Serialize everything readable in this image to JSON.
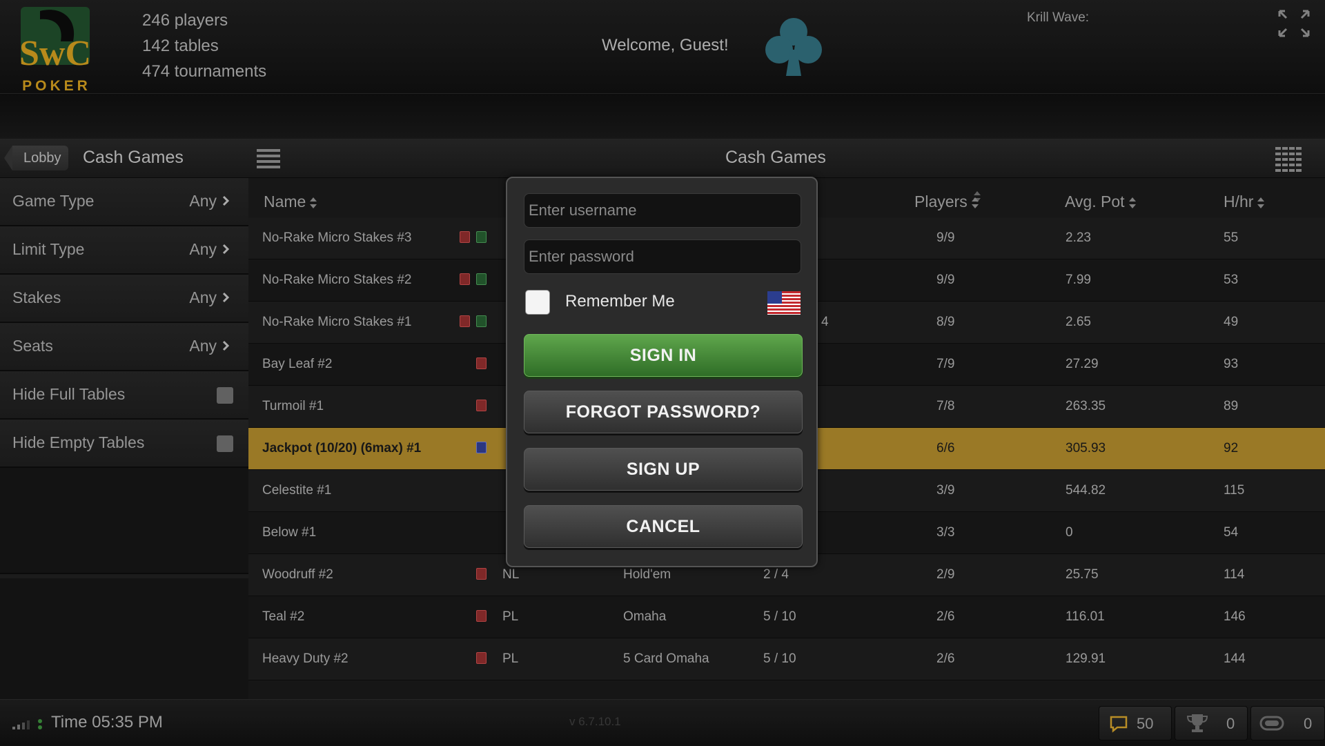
{
  "header": {
    "logo_text": "SwC",
    "logo_sub": "POKER",
    "stats": [
      "246 players",
      "142 tables",
      "474 tournaments"
    ],
    "welcome": "Welcome, Guest!",
    "krill": "Krill Wave:",
    "club_icon": "club-suit-icon",
    "fullscreen_icon": "fullscreen-icon"
  },
  "toolbar": {
    "lobby": "Lobby",
    "title": "Cash Games",
    "center_title": "Cash Games",
    "menu_icon": "hamburger-menu-icon",
    "grid_icon": "grid-view-icon"
  },
  "sidebar": {
    "filters": [
      {
        "label": "Game Type",
        "value": "Any"
      },
      {
        "label": "Limit Type",
        "value": "Any"
      },
      {
        "label": "Stakes",
        "value": "Any"
      },
      {
        "label": "Seats",
        "value": "Any"
      }
    ],
    "toggles": [
      {
        "label": "Hide Full Tables",
        "checked": false
      },
      {
        "label": "Hide Empty Tables",
        "checked": false
      }
    ]
  },
  "table": {
    "columns": {
      "name": "Name",
      "players": "Players",
      "avg_pot": "Avg. Pot",
      "hhr": "H/hr"
    },
    "rows": [
      {
        "name": "No-Rake Micro Stakes #3",
        "icons": [
          "red",
          "green"
        ],
        "limit": "",
        "game": "",
        "stakes": "",
        "players": "9/9",
        "avg_pot": "2.23",
        "hhr": "55",
        "highlight": false
      },
      {
        "name": "No-Rake Micro Stakes #2",
        "icons": [
          "red",
          "green"
        ],
        "limit": "",
        "game": "",
        "stakes": "",
        "players": "9/9",
        "avg_pot": "7.99",
        "hhr": "53",
        "highlight": false
      },
      {
        "name": "No-Rake Micro Stakes #1",
        "icons": [
          "red",
          "green"
        ],
        "limit": "",
        "game": "",
        "stakes": "4",
        "players": "8/9",
        "avg_pot": "2.65",
        "hhr": "49",
        "highlight": false
      },
      {
        "name": "Bay Leaf #2",
        "icons": [
          "red"
        ],
        "limit": "",
        "game": "",
        "stakes": "",
        "players": "7/9",
        "avg_pot": "27.29",
        "hhr": "93",
        "highlight": false
      },
      {
        "name": "Turmoil #1",
        "icons": [
          "red"
        ],
        "limit": "",
        "game": "",
        "stakes": "",
        "players": "7/8",
        "avg_pot": "263.35",
        "hhr": "89",
        "highlight": false
      },
      {
        "name": "Jackpot (10/20) (6max) #1",
        "icons": [
          "blue"
        ],
        "limit": "",
        "game": "",
        "stakes": "",
        "players": "6/6",
        "avg_pot": "305.93",
        "hhr": "92",
        "highlight": true
      },
      {
        "name": "Celestite #1",
        "icons": [],
        "limit": "",
        "game": "",
        "stakes": "",
        "players": "3/9",
        "avg_pot": "544.82",
        "hhr": "115",
        "highlight": false
      },
      {
        "name": "Below #1",
        "icons": [],
        "limit": "",
        "game": "",
        "stakes": "",
        "players": "3/3",
        "avg_pot": "0",
        "hhr": "54",
        "highlight": false
      },
      {
        "name": "Woodruff #2",
        "icons": [
          "red"
        ],
        "limit": "NL",
        "game": "Hold'em",
        "stakes": "2 / 4",
        "players": "2/9",
        "avg_pot": "25.75",
        "hhr": "114",
        "highlight": false
      },
      {
        "name": "Teal #2",
        "icons": [
          "red"
        ],
        "limit": "PL",
        "game": "Omaha",
        "stakes": "5 / 10",
        "players": "2/6",
        "avg_pot": "116.01",
        "hhr": "146",
        "highlight": false
      },
      {
        "name": "Heavy Duty #2",
        "icons": [
          "red"
        ],
        "limit": "PL",
        "game": "5 Card Omaha",
        "stakes": "5 / 10",
        "players": "2/6",
        "avg_pot": "129.91",
        "hhr": "144",
        "highlight": false
      }
    ]
  },
  "footer": {
    "time": "Time 05:35 PM",
    "version": "v 6.7.10.1",
    "chat_count": "50",
    "trophy_count": "0",
    "chips_count": "0"
  },
  "modal": {
    "username_placeholder": "Enter username",
    "password_placeholder": "Enter password",
    "remember": "Remember Me",
    "sign_in": "SIGN IN",
    "forgot": "FORGOT PASSWORD?",
    "sign_up": "SIGN UP",
    "cancel": "CANCEL"
  }
}
